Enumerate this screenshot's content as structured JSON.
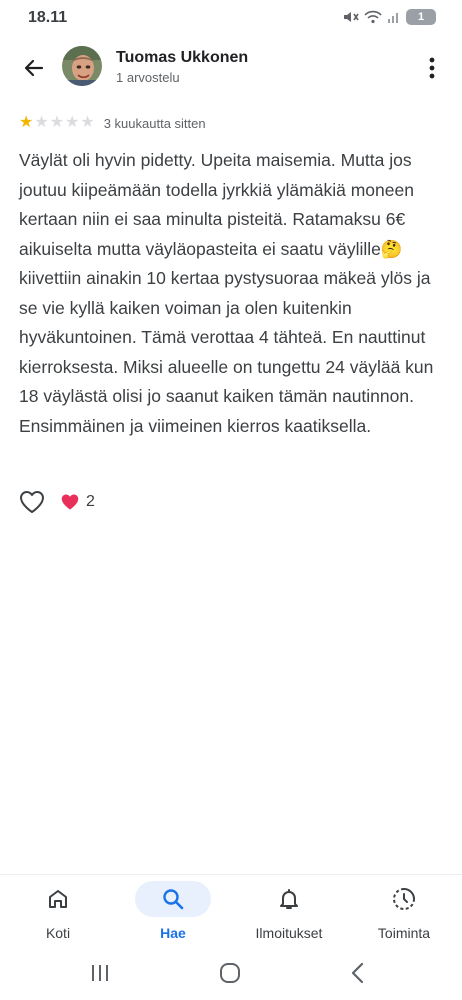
{
  "status_bar": {
    "time": "18.11",
    "icons": [
      "mute-icon",
      "wifi-icon",
      "signal-icon"
    ],
    "battery_label": "1"
  },
  "header": {
    "reviewer_name": "Tuomas Ukkonen",
    "review_count": "1 arvostelu",
    "icons": [
      "back-arrow-icon",
      "avatar",
      "more-vert-icon"
    ]
  },
  "review": {
    "rating": 1,
    "max_rating": 5,
    "date": "3 kuukautta sitten",
    "text": "Väylät oli hyvin pidetty. Upeita maisemia. Mutta jos joutuu kiipeämään todella jyrkkiä ylämäkiä moneen kertaan niin ei saa minulta pisteitä. Ratamaksu 6€ aikuiselta mutta väyläopasteita ei saatu väylille🤔 kiivettiin ainakin 10 kertaa pystysuoraa mäkeä ylös ja se vie kyllä kaiken voiman ja olen kuitenkin hyväkuntoinen. Tämä verottaa 4 tähteä. En nauttinut kierroksesta. Miksi alueelle on tungettu 24 väylää kun 18 väylästä olisi jo saanut kaiken tämän nautinnon. Ensimmäinen ja viimeinen kierros kaatiksella."
  },
  "reactions": {
    "heart_count": "2",
    "icons": [
      "heart-outline-icon",
      "heart-filled-icon"
    ]
  },
  "bottom_nav": {
    "items": [
      {
        "label": "Koti",
        "icon": "home-icon",
        "active": false
      },
      {
        "label": "Hae",
        "icon": "search-icon",
        "active": true
      },
      {
        "label": "Ilmoitukset",
        "icon": "bell-icon",
        "active": false
      },
      {
        "label": "Toiminta",
        "icon": "activity-icon",
        "active": false
      }
    ]
  },
  "system_nav": {
    "icons": [
      "recents-icon",
      "home-pill-icon",
      "back-chevron-icon"
    ]
  },
  "colors": {
    "accent": "#1a73e8",
    "accent_bg": "#e8f0fe",
    "star": "#f2b600",
    "heart": "#e8305a",
    "text": "#3c4043"
  }
}
